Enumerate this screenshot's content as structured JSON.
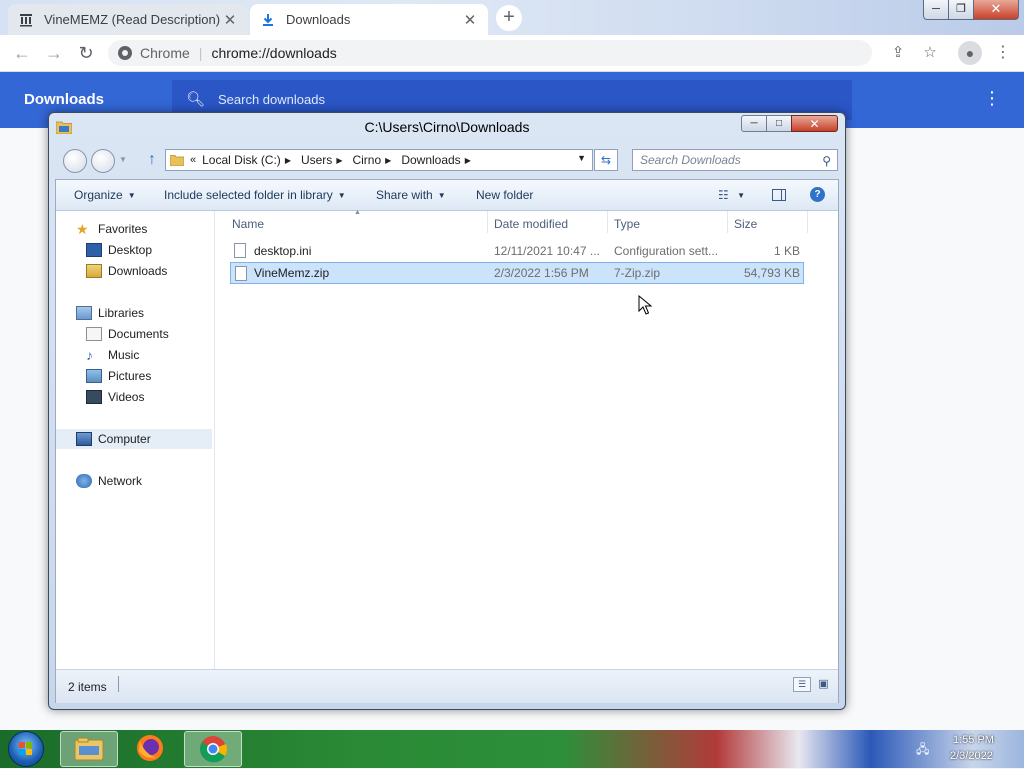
{
  "chrome": {
    "tabs": [
      {
        "title": "VineMEMZ (Read Description) : F",
        "close": "✕"
      },
      {
        "title": "Downloads",
        "close": "✕"
      }
    ],
    "new_tab": "+",
    "omnibox": {
      "origin": "Chrome",
      "separator": "|",
      "url": "chrome://downloads"
    },
    "window_controls": {
      "min": "─",
      "max": "❐",
      "close": "✕"
    }
  },
  "downloads_page": {
    "title": "Downloads",
    "search_placeholder": "Search downloads",
    "accent": "#3367d6"
  },
  "explorer": {
    "title": "C:\\Users\\Cirno\\Downloads",
    "breadcrumb": [
      "Local Disk (C:)",
      "Users",
      "Cirno",
      "Downloads"
    ],
    "search_placeholder": "Search Downloads",
    "commands": {
      "organize": "Organize",
      "include": "Include selected folder in library",
      "share": "Share with",
      "new_folder": "New folder"
    },
    "nav": {
      "favorites": "Favorites",
      "desktop": "Desktop",
      "downloads": "Downloads",
      "libraries": "Libraries",
      "documents": "Documents",
      "music": "Music",
      "pictures": "Pictures",
      "videos": "Videos",
      "computer": "Computer",
      "network": "Network"
    },
    "columns": {
      "name": "Name",
      "date": "Date modified",
      "type": "Type",
      "size": "Size"
    },
    "files": [
      {
        "name": "desktop.ini",
        "date": "12/11/2021 10:47 ...",
        "type": "Configuration sett...",
        "size": "1 KB"
      },
      {
        "name": "VineMemz.zip",
        "date": "2/3/2022 1:56 PM",
        "type": "7-Zip.zip",
        "size": "54,793 KB"
      }
    ],
    "status": "2 items",
    "window_controls": {
      "min": "─",
      "max": "□",
      "close": "✕"
    }
  },
  "taskbar": {
    "time": "1:55 PM",
    "date": "2/3/2022"
  }
}
